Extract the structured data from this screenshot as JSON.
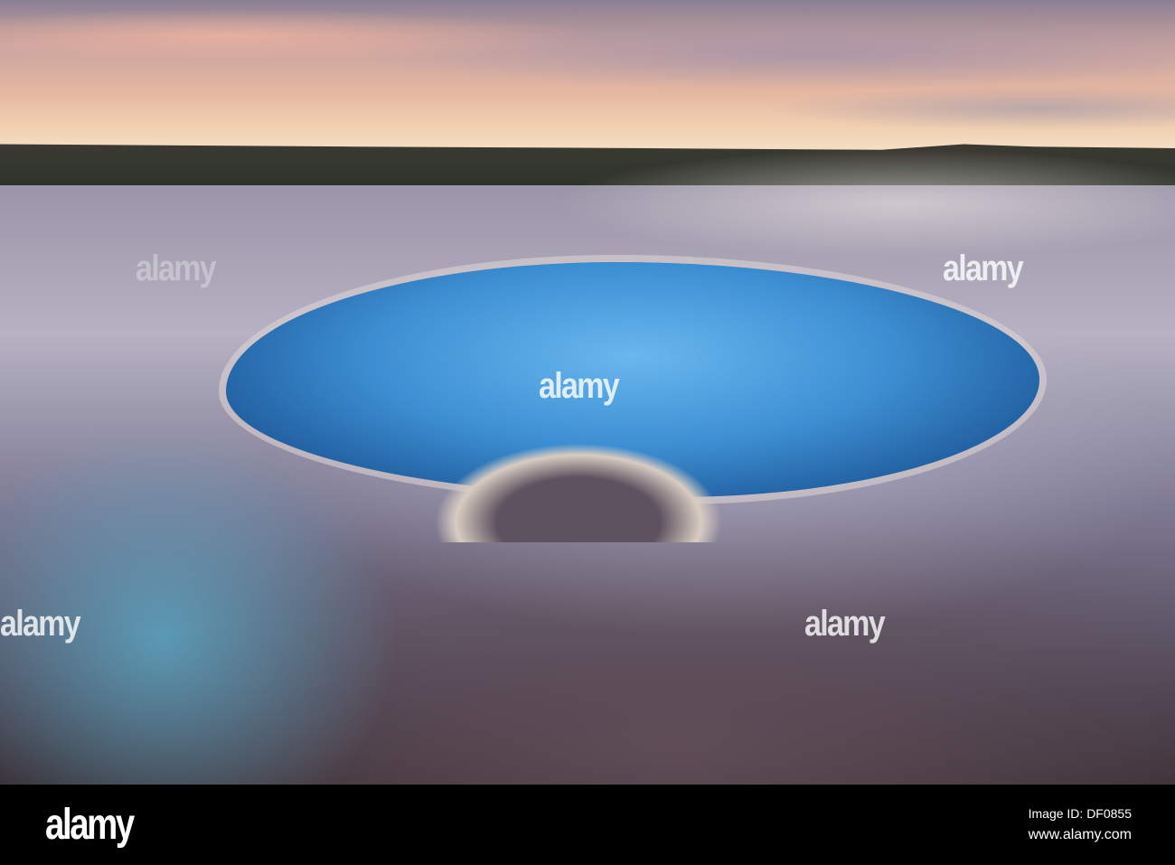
{
  "photo": {
    "subject": "hot spring pool at sunset",
    "watermark": "alamy"
  },
  "footer": {
    "logo": "alamy",
    "image_id": "Image ID: DF0855",
    "website": "www.alamy.com"
  }
}
